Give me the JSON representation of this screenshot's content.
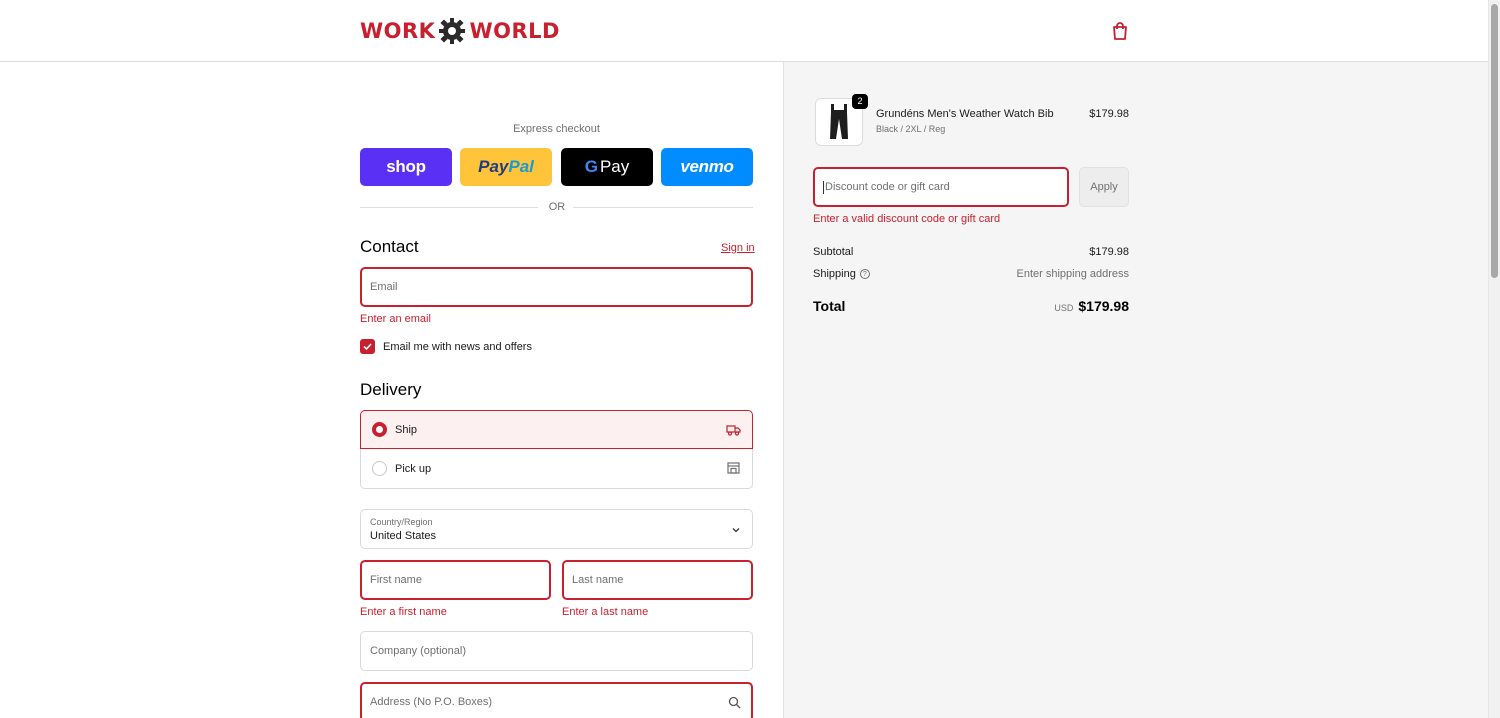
{
  "header": {
    "logo_left": "WORK",
    "logo_right": "WORLD",
    "cart_icon": "shopping-bag-icon"
  },
  "express": {
    "title": "Express checkout",
    "shop_label": "shop",
    "paypal_label_1": "Pay",
    "paypal_label_2": "Pal",
    "gpay_label_g": "G",
    "gpay_label": "Pay",
    "venmo_label": "venmo",
    "or_label": "OR"
  },
  "contact": {
    "title": "Contact",
    "sign_in": "Sign in",
    "email_placeholder": "Email",
    "email_error": "Enter an email",
    "newsletter_label": "Email me with news and offers",
    "newsletter_checked": true
  },
  "delivery": {
    "title": "Delivery",
    "options": [
      {
        "label": "Ship",
        "selected": true,
        "icon": "truck-icon"
      },
      {
        "label": "Pick up",
        "selected": false,
        "icon": "store-icon"
      }
    ],
    "country_label": "Country/Region",
    "country_value": "United States",
    "first_name_placeholder": "First name",
    "first_name_error": "Enter a first name",
    "last_name_placeholder": "Last name",
    "last_name_error": "Enter a last name",
    "company_placeholder": "Company (optional)",
    "address_placeholder": "Address (No P.O. Boxes)"
  },
  "summary": {
    "product": {
      "name": "Grundéns Men's Weather Watch Bib",
      "variant": "Black / 2XL / Reg",
      "price": "$179.98",
      "quantity": "2"
    },
    "discount_placeholder": "Discount code or gift card",
    "apply_label": "Apply",
    "discount_error": "Enter a valid discount code or gift card",
    "subtotal_label": "Subtotal",
    "subtotal_value": "$179.98",
    "shipping_label": "Shipping",
    "shipping_value": "Enter shipping address",
    "total_label": "Total",
    "currency": "USD",
    "total_value": "$179.98"
  },
  "colors": {
    "brand": "#c8202f",
    "shop": "#5a31f4",
    "paypal": "#ffc439",
    "gpay": "#000000",
    "venmo": "#008cff"
  }
}
